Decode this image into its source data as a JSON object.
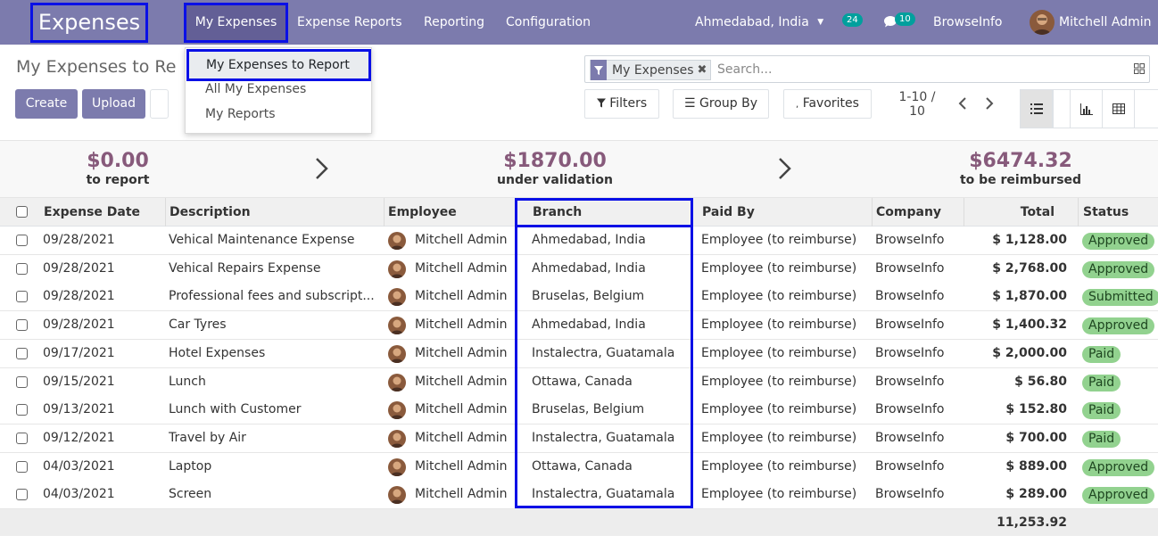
{
  "navbar": {
    "app_title": "Expenses",
    "menus": [
      "My Expenses",
      "Expense Reports",
      "Reporting",
      "Configuration"
    ],
    "branch_selector": "Ahmedabad, India",
    "activity_count": "24",
    "message_count": "10",
    "company": "BrowseInfo",
    "user": "Mitchell Admin"
  },
  "dropdown": {
    "items": [
      "My Expenses to Report",
      "All My Expenses",
      "My Reports"
    ]
  },
  "control_panel": {
    "breadcrumb": "My Expenses to Re",
    "create_label": "Create",
    "upload_label": "Upload",
    "facet_label": "My Expenses",
    "search_placeholder": "Search...",
    "filters_label": "Filters",
    "groupby_label": "Group By",
    "favorites_label": "Favorites",
    "pager_range": "1-10 /",
    "pager_total": "10"
  },
  "summary": {
    "to_report_amount": "$0.00",
    "to_report_label": "to report",
    "validation_amount": "$1870.00",
    "validation_label": "under validation",
    "reimbursed_amount": "$6474.32",
    "reimbursed_label": "to be reimbursed"
  },
  "table": {
    "columns": [
      "Expense Date",
      "Description",
      "Employee",
      "Branch",
      "Paid By",
      "Company",
      "Total",
      "Status"
    ],
    "rows": [
      {
        "date": "09/28/2021",
        "description": "Vehical Maintenance Expense",
        "employee": "Mitchell Admin",
        "branch": "Ahmedabad, India",
        "paid_by": "Employee (to reimburse)",
        "company": "BrowseInfo",
        "total": "$ 1,128.00",
        "status": "Approved"
      },
      {
        "date": "09/28/2021",
        "description": "Vehical Repairs Expense",
        "employee": "Mitchell Admin",
        "branch": "Ahmedabad, India",
        "paid_by": "Employee (to reimburse)",
        "company": "BrowseInfo",
        "total": "$ 2,768.00",
        "status": "Approved"
      },
      {
        "date": "09/28/2021",
        "description": "Professional fees and subscript...",
        "employee": "Mitchell Admin",
        "branch": "Bruselas, Belgium",
        "paid_by": "Employee (to reimburse)",
        "company": "BrowseInfo",
        "total": "$ 1,870.00",
        "status": "Submitted"
      },
      {
        "date": "09/28/2021",
        "description": "Car Tyres",
        "employee": "Mitchell Admin",
        "branch": "Ahmedabad, India",
        "paid_by": "Employee (to reimburse)",
        "company": "BrowseInfo",
        "total": "$ 1,400.32",
        "status": "Approved"
      },
      {
        "date": "09/17/2021",
        "description": "Hotel Expenses",
        "employee": "Mitchell Admin",
        "branch": "Instalectra, Guatamala",
        "paid_by": "Employee (to reimburse)",
        "company": "BrowseInfo",
        "total": "$ 2,000.00",
        "status": "Paid"
      },
      {
        "date": "09/15/2021",
        "description": "Lunch",
        "employee": "Mitchell Admin",
        "branch": "Ottawa, Canada",
        "paid_by": "Employee (to reimburse)",
        "company": "BrowseInfo",
        "total": "$ 56.80",
        "status": "Paid"
      },
      {
        "date": "09/13/2021",
        "description": "Lunch with Customer",
        "employee": "Mitchell Admin",
        "branch": "Bruselas, Belgium",
        "paid_by": "Employee (to reimburse)",
        "company": "BrowseInfo",
        "total": "$ 152.80",
        "status": "Paid"
      },
      {
        "date": "09/12/2021",
        "description": "Travel by Air",
        "employee": "Mitchell Admin",
        "branch": "Instalectra, Guatamala",
        "paid_by": "Employee (to reimburse)",
        "company": "BrowseInfo",
        "total": "$ 700.00",
        "status": "Paid"
      },
      {
        "date": "04/03/2021",
        "description": "Laptop",
        "employee": "Mitchell Admin",
        "branch": "Ottawa, Canada",
        "paid_by": "Employee (to reimburse)",
        "company": "BrowseInfo",
        "total": "$ 889.00",
        "status": "Approved"
      },
      {
        "date": "04/03/2021",
        "description": "Screen",
        "employee": "Mitchell Admin",
        "branch": "Instalectra, Guatamala",
        "paid_by": "Employee (to reimburse)",
        "company": "BrowseInfo",
        "total": "$ 289.00",
        "status": "Approved"
      }
    ],
    "grand_total": "11,253.92"
  },
  "colors": {
    "navbar": "#7c7bad",
    "highlight_box": "#0a10e6",
    "amount": "#875a7b",
    "status_badge": "#92d28f"
  }
}
